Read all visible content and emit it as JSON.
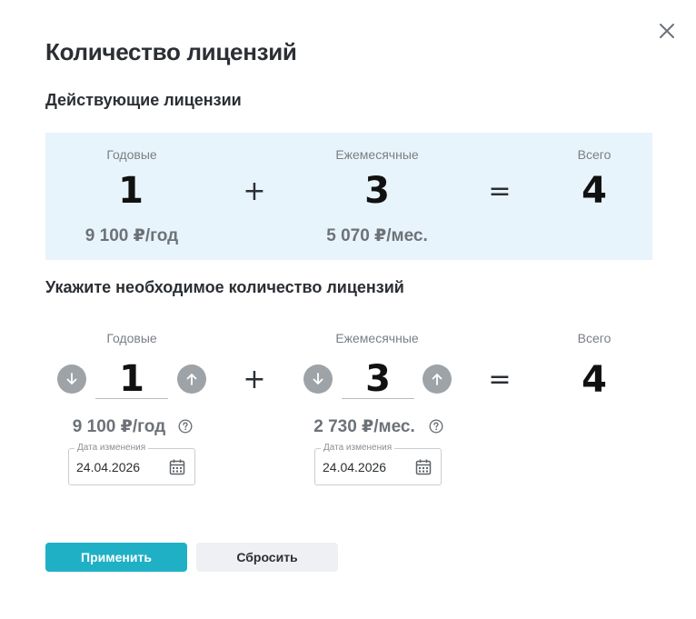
{
  "dialog": {
    "title": "Количество лицензий",
    "close_icon": "close-icon"
  },
  "current": {
    "section_title": "Действующие лицензии",
    "yearly_label": "Годовые",
    "monthly_label": "Ежемесячные",
    "total_label": "Всего",
    "yearly_count": "1",
    "monthly_count": "3",
    "total_count": "4",
    "plus": "+",
    "equals": "=",
    "yearly_price": "9 100 ₽/год",
    "monthly_price": "5 070 ₽/мес."
  },
  "required": {
    "section_title": "Укажите необходимое количество лицензий",
    "yearly_label": "Годовые",
    "monthly_label": "Ежемесячные",
    "total_label": "Всего",
    "yearly_count": "1",
    "monthly_count": "3",
    "total_count": "4",
    "plus": "+",
    "equals": "=",
    "yearly_price": "9 100 ₽/год",
    "monthly_price": "2 730 ₽/мес.",
    "yearly_date_label": "Дата изменения",
    "yearly_date": "24.04.2026",
    "monthly_date_label": "Дата изменения",
    "monthly_date": "24.04.2026"
  },
  "actions": {
    "apply_label": "Применить",
    "reset_label": "Сбросить"
  },
  "colors": {
    "panel_bg": "#e8f4fb",
    "accent": "#1fb0c6",
    "stepper_bg": "#9ea3a8"
  }
}
